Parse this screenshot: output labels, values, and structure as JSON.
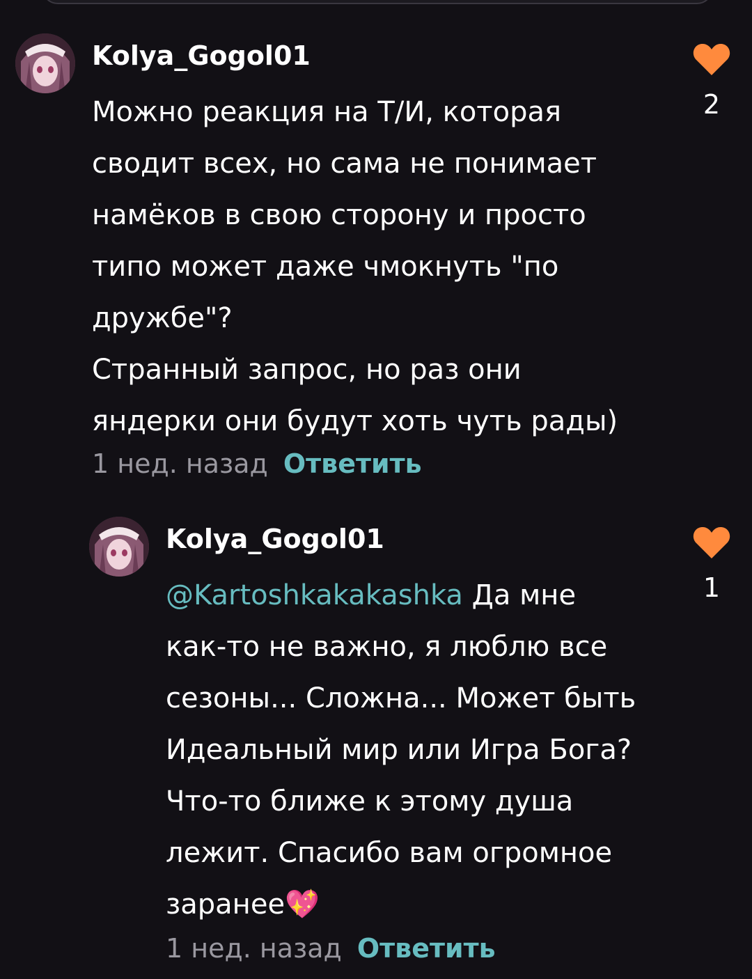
{
  "colors": {
    "background": "#121015",
    "accent": "#67bcc0",
    "like": "#ff8a3d",
    "meta": "#9a98a0"
  },
  "comments": [
    {
      "username": "Kolya_Gogol01",
      "text": "Можно реакция на Т/И, которая\nсводит всех, но сама не понимает\nнамёков в свою сторону и просто\nтипо может даже чмокнуть \"по\nдружбе\"?\nСтранный запрос, но раз они\nяндерки они будут хоть чуть рады)",
      "time": "1 нед. назад",
      "reply_label": "Ответить",
      "likes": "2",
      "avatar_icon": "avatar-image"
    },
    {
      "username": "Kolya_Gogol01",
      "mention": "@Kartoshkakakashka",
      "text": " Да мне\nкак-то не важно, я люблю все\nсезоны... Сложна... Может быть\nИдеальный мир или Игра Бога?\nЧто-то ближе к этому душа\nлежит. Спасибо вам огромное\nзаранее",
      "emoji": "💖",
      "time": "1 нед. назад",
      "reply_label": "Ответить",
      "likes": "1",
      "avatar_icon": "avatar-image"
    }
  ]
}
